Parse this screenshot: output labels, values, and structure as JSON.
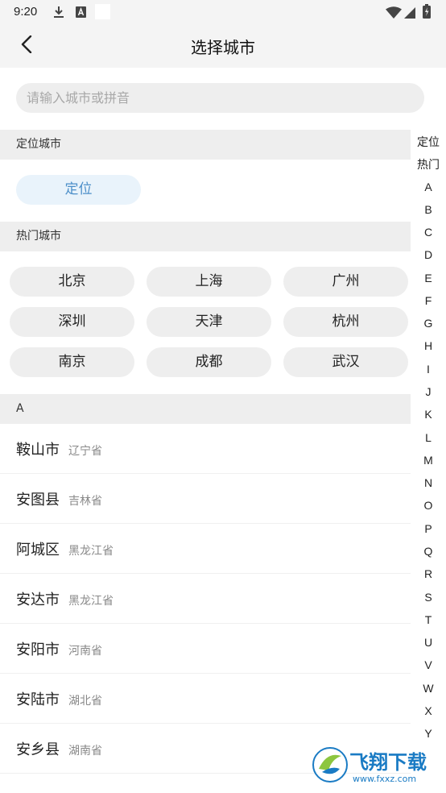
{
  "status_bar": {
    "time": "9:20",
    "icons": [
      "download-icon",
      "a-badge-icon",
      "blank-square-icon",
      "wifi-icon",
      "signal-icon",
      "battery-icon"
    ]
  },
  "header": {
    "title": "选择城市"
  },
  "search": {
    "placeholder": "请输入城市或拼音",
    "value": ""
  },
  "location": {
    "header": "定位城市",
    "button_label": "定位"
  },
  "hot": {
    "header": "热门城市",
    "cities": [
      "北京",
      "上海",
      "广州",
      "深圳",
      "天津",
      "杭州",
      "南京",
      "成都",
      "武汉"
    ]
  },
  "list": {
    "section_letter": "A",
    "cities": [
      {
        "name": "鞍山市",
        "province": "辽宁省"
      },
      {
        "name": "安图县",
        "province": "吉林省"
      },
      {
        "name": "阿城区",
        "province": "黑龙江省"
      },
      {
        "name": "安达市",
        "province": "黑龙江省"
      },
      {
        "name": "安阳市",
        "province": "河南省"
      },
      {
        "name": "安陆市",
        "province": "湖北省"
      },
      {
        "name": "安乡县",
        "province": "湖南省"
      }
    ]
  },
  "index_bar": [
    "定位",
    "热门",
    "A",
    "B",
    "C",
    "D",
    "E",
    "F",
    "G",
    "H",
    "I",
    "J",
    "K",
    "L",
    "M",
    "N",
    "O",
    "P",
    "Q",
    "R",
    "S",
    "T",
    "U",
    "V",
    "W",
    "X",
    "Y"
  ],
  "watermark": {
    "brand": "飞翔下载",
    "url": "www.fxxz.com",
    "colors": {
      "green": "#8dc63f",
      "blue": "#1a7bc4"
    }
  },
  "colors": {
    "accent": "#4c8fc9",
    "accent_bg": "#e9f3fb",
    "section_bg": "#eeeeee",
    "bar_bg": "#f4f4f4"
  }
}
